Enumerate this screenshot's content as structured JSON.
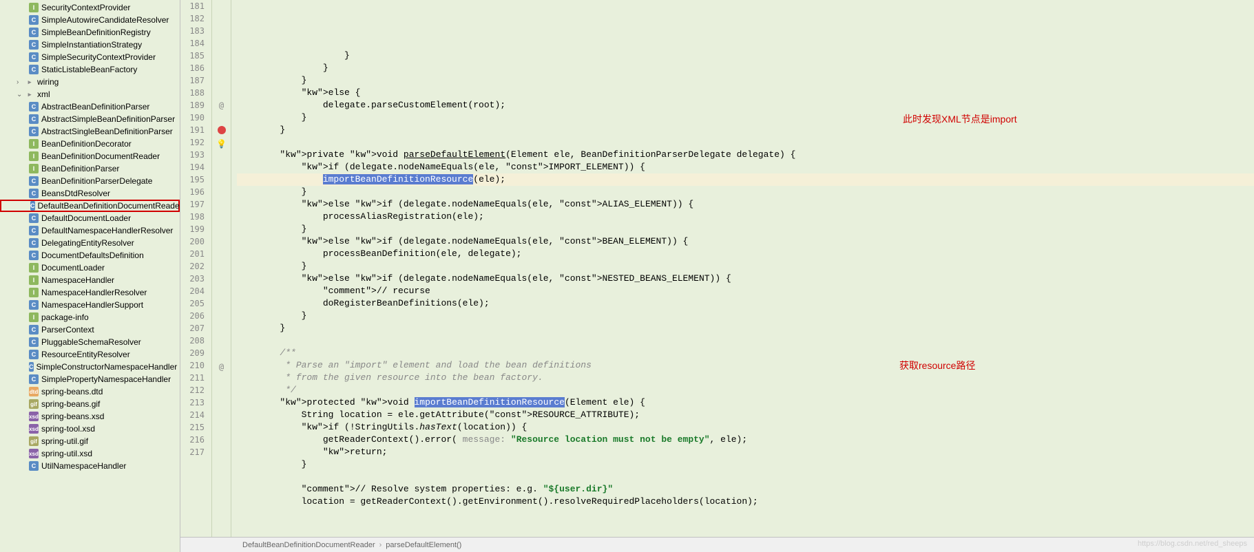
{
  "sidebar": {
    "items": [
      {
        "label": "SecurityContextProvider",
        "icon": "interface",
        "level": 2
      },
      {
        "label": "SimpleAutowireCandidateResolver",
        "icon": "class",
        "level": 2
      },
      {
        "label": "SimpleBeanDefinitionRegistry",
        "icon": "class",
        "level": 2
      },
      {
        "label": "SimpleInstantiationStrategy",
        "icon": "class",
        "level": 2
      },
      {
        "label": "SimpleSecurityContextProvider",
        "icon": "class",
        "level": 2
      },
      {
        "label": "StaticListableBeanFactory",
        "icon": "class",
        "level": 2
      },
      {
        "label": "wiring",
        "icon": "folder",
        "level": 1,
        "expand": "›"
      },
      {
        "label": "xml",
        "icon": "folder",
        "level": 1,
        "expand": "⌄"
      },
      {
        "label": "AbstractBeanDefinitionParser",
        "icon": "class",
        "level": 2
      },
      {
        "label": "AbstractSimpleBeanDefinitionParser",
        "icon": "class",
        "level": 2
      },
      {
        "label": "AbstractSingleBeanDefinitionParser",
        "icon": "class",
        "level": 2
      },
      {
        "label": "BeanDefinitionDecorator",
        "icon": "interface",
        "level": 2
      },
      {
        "label": "BeanDefinitionDocumentReader",
        "icon": "interface",
        "level": 2
      },
      {
        "label": "BeanDefinitionParser",
        "icon": "interface",
        "level": 2
      },
      {
        "label": "BeanDefinitionParserDelegate",
        "icon": "class",
        "level": 2
      },
      {
        "label": "BeansDtdResolver",
        "icon": "class",
        "level": 2
      },
      {
        "label": "DefaultBeanDefinitionDocumentReader",
        "icon": "class",
        "level": 2,
        "highlighted": true
      },
      {
        "label": "DefaultDocumentLoader",
        "icon": "class",
        "level": 2
      },
      {
        "label": "DefaultNamespaceHandlerResolver",
        "icon": "class",
        "level": 2
      },
      {
        "label": "DelegatingEntityResolver",
        "icon": "class",
        "level": 2
      },
      {
        "label": "DocumentDefaultsDefinition",
        "icon": "class",
        "level": 2
      },
      {
        "label": "DocumentLoader",
        "icon": "interface",
        "level": 2
      },
      {
        "label": "NamespaceHandler",
        "icon": "interface",
        "level": 2
      },
      {
        "label": "NamespaceHandlerResolver",
        "icon": "interface",
        "level": 2
      },
      {
        "label": "NamespaceHandlerSupport",
        "icon": "class",
        "level": 2
      },
      {
        "label": "package-info",
        "icon": "interface",
        "level": 2
      },
      {
        "label": "ParserContext",
        "icon": "class",
        "level": 2
      },
      {
        "label": "PluggableSchemaResolver",
        "icon": "class",
        "level": 2
      },
      {
        "label": "ResourceEntityResolver",
        "icon": "class",
        "level": 2
      },
      {
        "label": "SimpleConstructorNamespaceHandler",
        "icon": "class",
        "level": 2
      },
      {
        "label": "SimplePropertyNamespaceHandler",
        "icon": "class",
        "level": 2
      },
      {
        "label": "spring-beans.dtd",
        "icon": "dtd",
        "level": 2
      },
      {
        "label": "spring-beans.gif",
        "icon": "gif",
        "level": 2
      },
      {
        "label": "spring-beans.xsd",
        "icon": "xsd",
        "level": 2
      },
      {
        "label": "spring-tool.xsd",
        "icon": "xsd",
        "level": 2
      },
      {
        "label": "spring-util.gif",
        "icon": "gif",
        "level": 2
      },
      {
        "label": "spring-util.xsd",
        "icon": "xsd",
        "level": 2
      },
      {
        "label": "UtilNamespaceHandler",
        "icon": "class",
        "level": 2
      }
    ]
  },
  "gutter": {
    "lines": [
      "181",
      "182",
      "183",
      "184",
      "185",
      "186",
      "187",
      "188",
      "189",
      "190",
      "191",
      "192",
      "193",
      "194",
      "195",
      "196",
      "197",
      "198",
      "199",
      "200",
      "201",
      "202",
      "203",
      "204",
      "205",
      "206",
      "207",
      "208",
      "209",
      "210",
      "211",
      "212",
      "213",
      "214",
      "215",
      "216",
      "217"
    ],
    "icons": [
      "",
      "",
      "",
      "",
      "",
      "",
      "",
      "",
      "@",
      "",
      "●💡",
      "",
      "",
      "",
      "",
      "",
      "",
      "",
      "",
      "",
      "",
      "",
      "",
      "",
      "",
      "",
      "",
      "",
      "@",
      "",
      "",
      "",
      "",
      "",
      "",
      "",
      ""
    ]
  },
  "code": {
    "lines": [
      "                    }",
      "                }",
      "            }",
      "            else {",
      "                delegate.parseCustomElement(root);",
      "            }",
      "        }",
      "",
      "        private void parseDefaultElement(Element ele, BeanDefinitionParserDelegate delegate) {",
      "            if (delegate.nodeNameEquals(ele, IMPORT_ELEMENT)) {",
      "                importBeanDefinitionResource(ele);",
      "            }",
      "            else if (delegate.nodeNameEquals(ele, ALIAS_ELEMENT)) {",
      "                processAliasRegistration(ele);",
      "            }",
      "            else if (delegate.nodeNameEquals(ele, BEAN_ELEMENT)) {",
      "                processBeanDefinition(ele, delegate);",
      "            }",
      "            else if (delegate.nodeNameEquals(ele, NESTED_BEANS_ELEMENT)) {",
      "                // recurse",
      "                doRegisterBeanDefinitions(ele);",
      "            }",
      "        }",
      "",
      "        /**",
      "         * Parse an \"import\" element and load the bean definitions",
      "         * from the given resource into the bean factory.",
      "         */",
      "        protected void importBeanDefinitionResource(Element ele) {",
      "            String location = ele.getAttribute(RESOURCE_ATTRIBUTE);",
      "            if (!StringUtils.hasText(location)) {",
      "                getReaderContext().error( message: \"Resource location must not be empty\", ele);",
      "                return;",
      "            }",
      "",
      "            // Resolve system properties: e.g. \"${user.dir}\"",
      "            location = getReaderContext().getEnvironment().resolveRequiredPlaceholders(location);"
    ]
  },
  "annotations": {
    "ann1": "此时发现XML节点是import",
    "ann2": "获取resource路径"
  },
  "breadcrumb": {
    "file": "DefaultBeanDefinitionDocumentReader",
    "method": "parseDefaultElement()"
  },
  "watermark": "https://blog.csdn.net/red_sheeps"
}
